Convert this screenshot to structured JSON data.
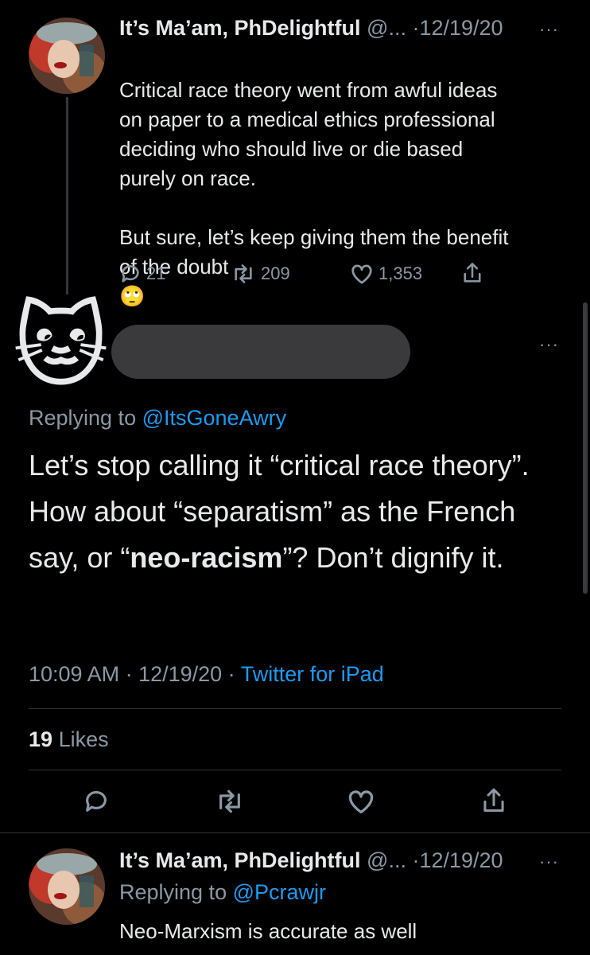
{
  "tweet1": {
    "display_name": "It’s Ma’am, PhDelightful",
    "handle": "@...",
    "date": "·12/19/20",
    "more": "···",
    "text": "Critical race theory went from awful ideas\non paper to a medical ethics professional\ndeciding who should live or die based\npurely on race.\n\nBut sure, let’s keep giving them the benefit\nof the doubt",
    "emoji": "🙄",
    "reply_count": "21",
    "retweet_count": "209",
    "like_count": "1,353"
  },
  "focused": {
    "avatar_emoji": "🐱",
    "more": "···",
    "replying_prefix": "Replying to",
    "replying_handle": "@ItsGoneAwry",
    "text_part1": "Let’s stop calling it “critical race theory”. How about “separatism” as the French say, or “",
    "text_bold": "neo-racism",
    "text_part2": "”? Don’t dignify it.",
    "time": "10:09 AM · 12/19/20 · ",
    "source": "Twitter for iPad",
    "likes_count": "19",
    "likes_label": "Likes"
  },
  "tweet3": {
    "display_name": "It’s Ma’am, PhDelightful",
    "handle": "@...",
    "date": "·12/19/20",
    "more": "···",
    "replying_prefix": "Replying to",
    "replying_handle": "@Pcrawjr",
    "text": "Neo-Marxism is accurate as well"
  },
  "icons": [
    "reply-icon",
    "retweet-icon",
    "like-icon",
    "share-icon"
  ],
  "colors": {
    "background": "#000000",
    "link": "#1d9bf0",
    "muted": "#8b98a5",
    "redacted": "#3a3a3c"
  }
}
